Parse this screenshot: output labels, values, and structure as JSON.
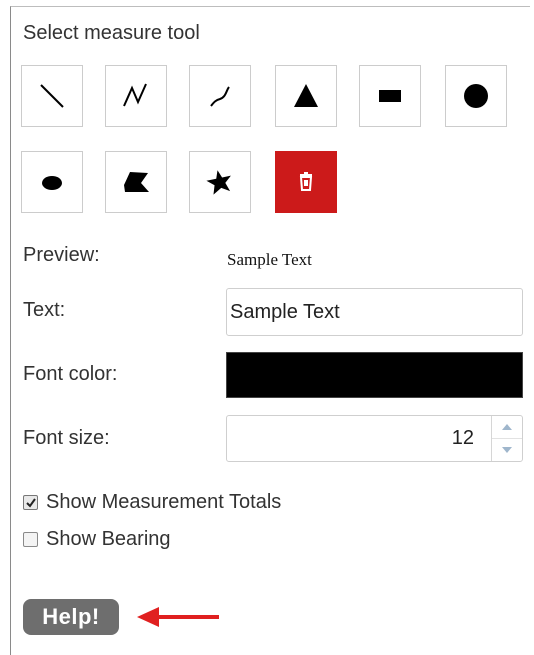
{
  "panel": {
    "title": "Select measure tool"
  },
  "tools": [
    {
      "name": "line-tool",
      "icon": "line-icon"
    },
    {
      "name": "polyline-tool",
      "icon": "polyline-icon"
    },
    {
      "name": "freehand-line-tool",
      "icon": "freehand-line-icon"
    },
    {
      "name": "triangle-tool",
      "icon": "triangle-icon"
    },
    {
      "name": "rectangle-tool",
      "icon": "rectangle-icon"
    },
    {
      "name": "circle-tool",
      "icon": "circle-icon"
    },
    {
      "name": "ellipse-tool",
      "icon": "ellipse-icon"
    },
    {
      "name": "polygon-tool",
      "icon": "polygon-icon"
    },
    {
      "name": "freehand-polygon-tool",
      "icon": "freehand-polygon-icon"
    },
    {
      "name": "delete-tool",
      "icon": "trash-icon",
      "color": "#cc1a1a"
    }
  ],
  "form": {
    "preview_label": "Preview:",
    "preview_text": "Sample Text",
    "text_label": "Text:",
    "text_value": "Sample Text",
    "font_color_label": "Font color:",
    "font_color_value": "#000000",
    "font_size_label": "Font size:",
    "font_size_value": "12"
  },
  "options": {
    "show_totals_label": "Show Measurement Totals",
    "show_totals_checked": true,
    "show_bearing_label": "Show Bearing",
    "show_bearing_checked": false
  },
  "help": {
    "label": "Help!",
    "arrow_color": "#e02020"
  }
}
